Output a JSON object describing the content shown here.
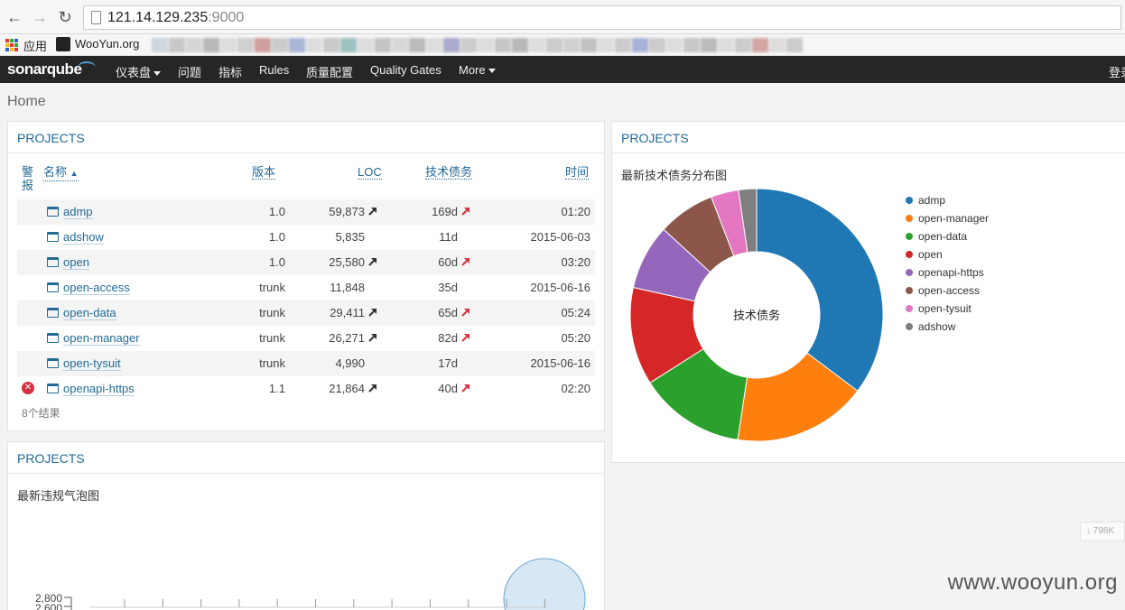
{
  "browser": {
    "address_host": "121.14.129.235",
    "address_port": ":9000",
    "bookmark_apps": "应用",
    "bookmark_wooyun": "WooYun.org"
  },
  "nav": {
    "logo": "sonarqube",
    "items": [
      "仪表盘",
      "问题",
      "指标",
      "Rules",
      "质量配置",
      "Quality Gates",
      "More"
    ],
    "login": "登录"
  },
  "breadcrumb": "Home",
  "projects_panel": {
    "title": "PROJECTS",
    "columns": {
      "alert": "警报",
      "name": "名称",
      "version": "版本",
      "loc": "LOC",
      "debt": "技术债务",
      "time": "时间"
    },
    "rows": [
      {
        "name": "admp",
        "version": "1.0",
        "loc": "59,873",
        "loc_trend": "up",
        "debt": "169d",
        "debt_trend": "up",
        "time": "01:20",
        "error": false
      },
      {
        "name": "adshow",
        "version": "1.0",
        "loc": "5,835",
        "loc_trend": "",
        "debt": "11d",
        "debt_trend": "",
        "time": "2015-06-03",
        "error": false
      },
      {
        "name": "open",
        "version": "1.0",
        "loc": "25,580",
        "loc_trend": "up",
        "debt": "60d",
        "debt_trend": "up",
        "time": "03:20",
        "error": false
      },
      {
        "name": "open-access",
        "version": "trunk",
        "loc": "11,848",
        "loc_trend": "",
        "debt": "35d",
        "debt_trend": "",
        "time": "2015-06-16",
        "error": false
      },
      {
        "name": "open-data",
        "version": "trunk",
        "loc": "29,411",
        "loc_trend": "up",
        "debt": "65d",
        "debt_trend": "up",
        "time": "05:24",
        "error": false
      },
      {
        "name": "open-manager",
        "version": "trunk",
        "loc": "26,271",
        "loc_trend": "up",
        "debt": "82d",
        "debt_trend": "up",
        "time": "05:20",
        "error": false
      },
      {
        "name": "open-tysuit",
        "version": "trunk",
        "loc": "4,990",
        "loc_trend": "",
        "debt": "17d",
        "debt_trend": "",
        "time": "2015-06-16",
        "error": false
      },
      {
        "name": "openapi-https",
        "version": "1.1",
        "loc": "21,864",
        "loc_trend": "up",
        "debt": "40d",
        "debt_trend": "up",
        "time": "02:20",
        "error": true
      }
    ],
    "result_count": "8个结果"
  },
  "donut_panel": {
    "title": "PROJECTS",
    "subtitle": "最新技术债务分布图",
    "center_label": "技术债务"
  },
  "bubble_panel": {
    "title": "PROJECTS",
    "subtitle": "最新违规气泡图",
    "y_ticks": [
      "2,800",
      "2,600"
    ]
  },
  "chart_data": {
    "type": "pie",
    "title": "最新技术债务分布图",
    "center_label": "技术债务",
    "categories": [
      "admp",
      "open-manager",
      "open-data",
      "open",
      "openapi-https",
      "open-access",
      "open-tysuit",
      "adshow"
    ],
    "values": [
      169,
      82,
      65,
      60,
      40,
      35,
      17,
      11
    ],
    "colors": [
      "#1f77b4",
      "#ff7f0e",
      "#2ca02c",
      "#d62728",
      "#9467bd",
      "#8c564b",
      "#e377c2",
      "#7f7f7f"
    ],
    "legend_position": "right"
  },
  "misc": {
    "watermark": "www.wooyun.org",
    "download_badge": "↓ 798K"
  }
}
